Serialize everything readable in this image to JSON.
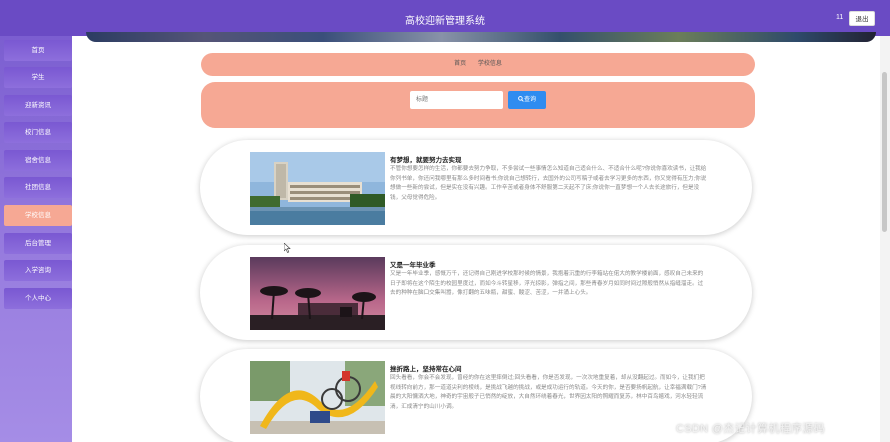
{
  "header": {
    "title": "高校迎新管理系统",
    "username": "11",
    "logout_label": "退出"
  },
  "sidebar": {
    "items": [
      {
        "label": "首页",
        "active": false
      },
      {
        "label": "学生",
        "active": false
      },
      {
        "label": "迎新资讯",
        "active": false
      },
      {
        "label": "校门信息",
        "active": false
      },
      {
        "label": "宿舍信息",
        "active": false
      },
      {
        "label": "社团信息",
        "active": false
      },
      {
        "label": "学校信息",
        "active": true
      },
      {
        "label": "后台管理",
        "active": false
      },
      {
        "label": "入学咨询",
        "active": false
      },
      {
        "label": "个人中心",
        "active": false
      }
    ]
  },
  "breadcrumb": {
    "home": "首页",
    "current": "学校信息"
  },
  "search": {
    "placeholder": "标题",
    "button_label": "查询"
  },
  "articles": [
    {
      "title": "有梦想，就要努力去实现",
      "description": "不管你想要怎样的生活，你都要去努力争取，不多尝试一些事情怎么知道自己适合什么、不适合什么呢?你说你喜欢读书，让我给你列书单，你还问我哪里有那么多时间看书;你说自己想转行，去国外的公司写稿子或者去学习更多的东西，你又觉得有压力;你说想做一些新的尝试，但是实在没有兴趣。工作辛苦或者身体不舒服第二天起不了床;你说你一直梦想一个人去长途旅行，但是没钱，父母觉得危险。"
    },
    {
      "title": "又是一年毕业季",
      "description": "又是一年毕业季，感慨万千，还记得自己刚进学校那时候的情景，我抱着沉重的行李箱站在偌大的教学楼前面，感叹自己未来的日子即将在这个陌生的校园里度过，而如今斗转星移，浮光掠影，弹指之间，那些青春岁月如同时间过隙般悄然从指缝溜走。过去的种种在脑口交集叫嚣，像打翻的五味瓶，甜蜜、酸涩、苦涩，一并涌上心头。"
    },
    {
      "title": "挫折路上，坚持常在心间",
      "description": "回头看看，你会不会发现，曾经的你在这里摔倒过;回头看看，你是否发现，一次次地重复着，却从没翻起过。而如今，让我们把视线转向前方，那一道道尖利的棱线，是挑战飞越的挑战，或是成功运行的轨道。今天的你，是否要扬帆起航，让幸福满载门?清晨的大阳慵洒大地，神奇的宇宙般子已悄然的绽放，大自然环绕着春光，世界因太阳的照耀而复苏，林中百鸟嬉戏，河水轻轻流淌，汇成清宁的山川小调。"
    }
  ],
  "watermark": "CSDN @杰记计算机程序源码"
}
